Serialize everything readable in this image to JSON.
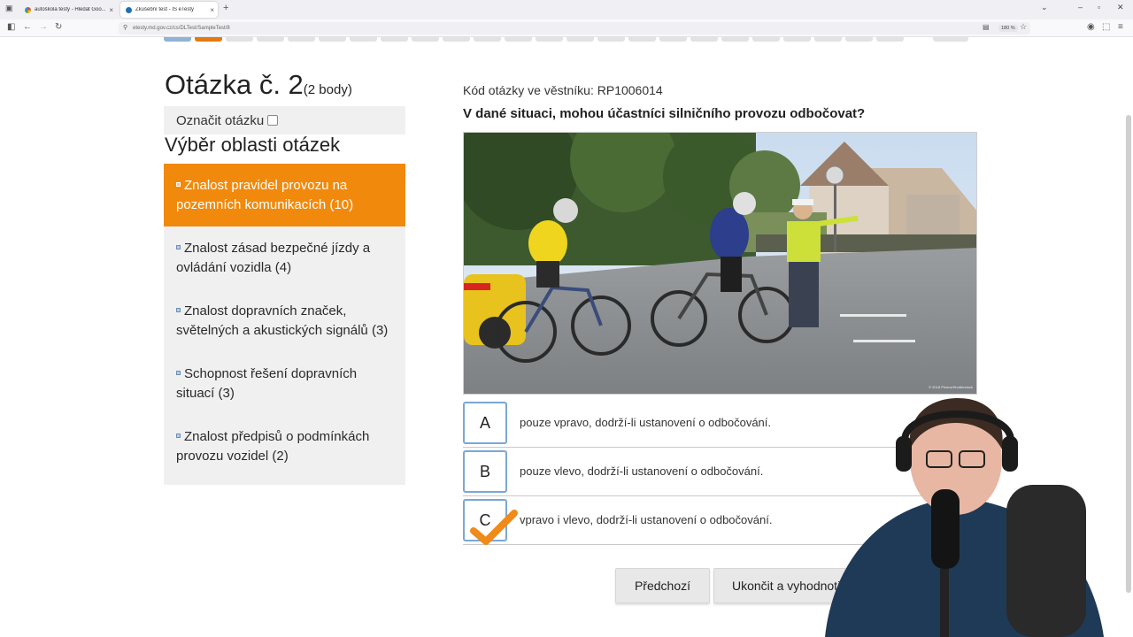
{
  "browser": {
    "tabs": [
      {
        "label": "autoškola testy - Hledat Goo...",
        "active": false
      },
      {
        "label": "Zkušební test - IS eTesty",
        "active": true
      }
    ],
    "url": "etesty.md.gov.cz/cs/DLTest/SampleTest/8",
    "zoom": "180 %"
  },
  "question_nav": {
    "cell_count": 24,
    "answered_index": 0,
    "current_index": 1
  },
  "question": {
    "title": "Otázka č. 2",
    "points": "(2 body)",
    "mark_label": "Označit otázku",
    "code": "Kód otázky ve věstníku: RP1006014",
    "text": "V dané situaci, mohou účastníci silničního provozu odbočovat?",
    "photo_caption": "© 2018 Photos/Shutterstock"
  },
  "areas": {
    "heading": "Výběr oblasti otázek",
    "items": [
      {
        "label": "Znalost pravidel provozu na pozemních komunikacích (10)",
        "active": true
      },
      {
        "label": "Znalost zásad bezpečné jízdy a ovládání vozidla (4)",
        "active": false
      },
      {
        "label": "Znalost dopravních značek, světelných a akustických signálů (3)",
        "active": false
      },
      {
        "label": "Schopnost řešení dopravních situací (3)",
        "active": false
      },
      {
        "label": "Znalost předpisů o podmínkách provozu vozidel (2)",
        "active": false
      }
    ]
  },
  "answers": [
    {
      "letter": "A",
      "text": "pouze vpravo, dodrží-li ustanovení o odbočování.",
      "checked": false
    },
    {
      "letter": "B",
      "text": "pouze vlevo, dodrží-li ustanovení o odbočování.",
      "checked": false
    },
    {
      "letter": "C",
      "text": "vpravo i vlevo, dodrží-li ustanovení o odbočování.",
      "checked": true
    }
  ],
  "buttons": {
    "prev": "Předchozí",
    "finish": "Ukončit a vyhodnotit"
  },
  "colors": {
    "accent": "#f18a0c",
    "answer_border": "#7aa7d3",
    "check": "#f08a18"
  }
}
